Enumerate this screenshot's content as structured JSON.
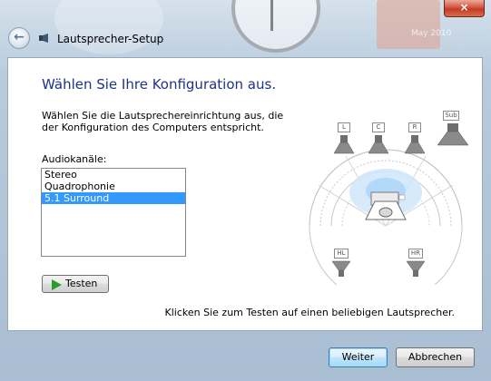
{
  "window": {
    "title": "Lautsprecher-Setup",
    "close_glyph": "×",
    "back_glyph": "←"
  },
  "background": {
    "gadget_text": "May 2010"
  },
  "main": {
    "heading": "Wählen Sie Ihre Konfiguration aus.",
    "description": "Wählen Sie die Lautsprechereinrichtung aus, die der Konfiguration des Computers entspricht.",
    "channels_label": "Audiokanäle:",
    "channels": [
      "Stereo",
      "Quadrophonie",
      "5.1 Surround"
    ],
    "selected_channel": "5.1 Surround",
    "test_button": "Testen",
    "hint": "Klicken Sie zum Testen auf einen beliebigen Lautsprecher."
  },
  "speakers": {
    "front_left": "L",
    "center": "C",
    "front_right": "R",
    "subwoofer": "Sub",
    "rear_left": "HL",
    "rear_right": "HR"
  },
  "footer": {
    "next_button": "Weiter",
    "cancel_button": "Abbrechen"
  },
  "colors": {
    "heading": "#1e3287",
    "selection": "#3399ff",
    "close_button": "#c23a22",
    "play_icon": "#2a9c2a"
  }
}
